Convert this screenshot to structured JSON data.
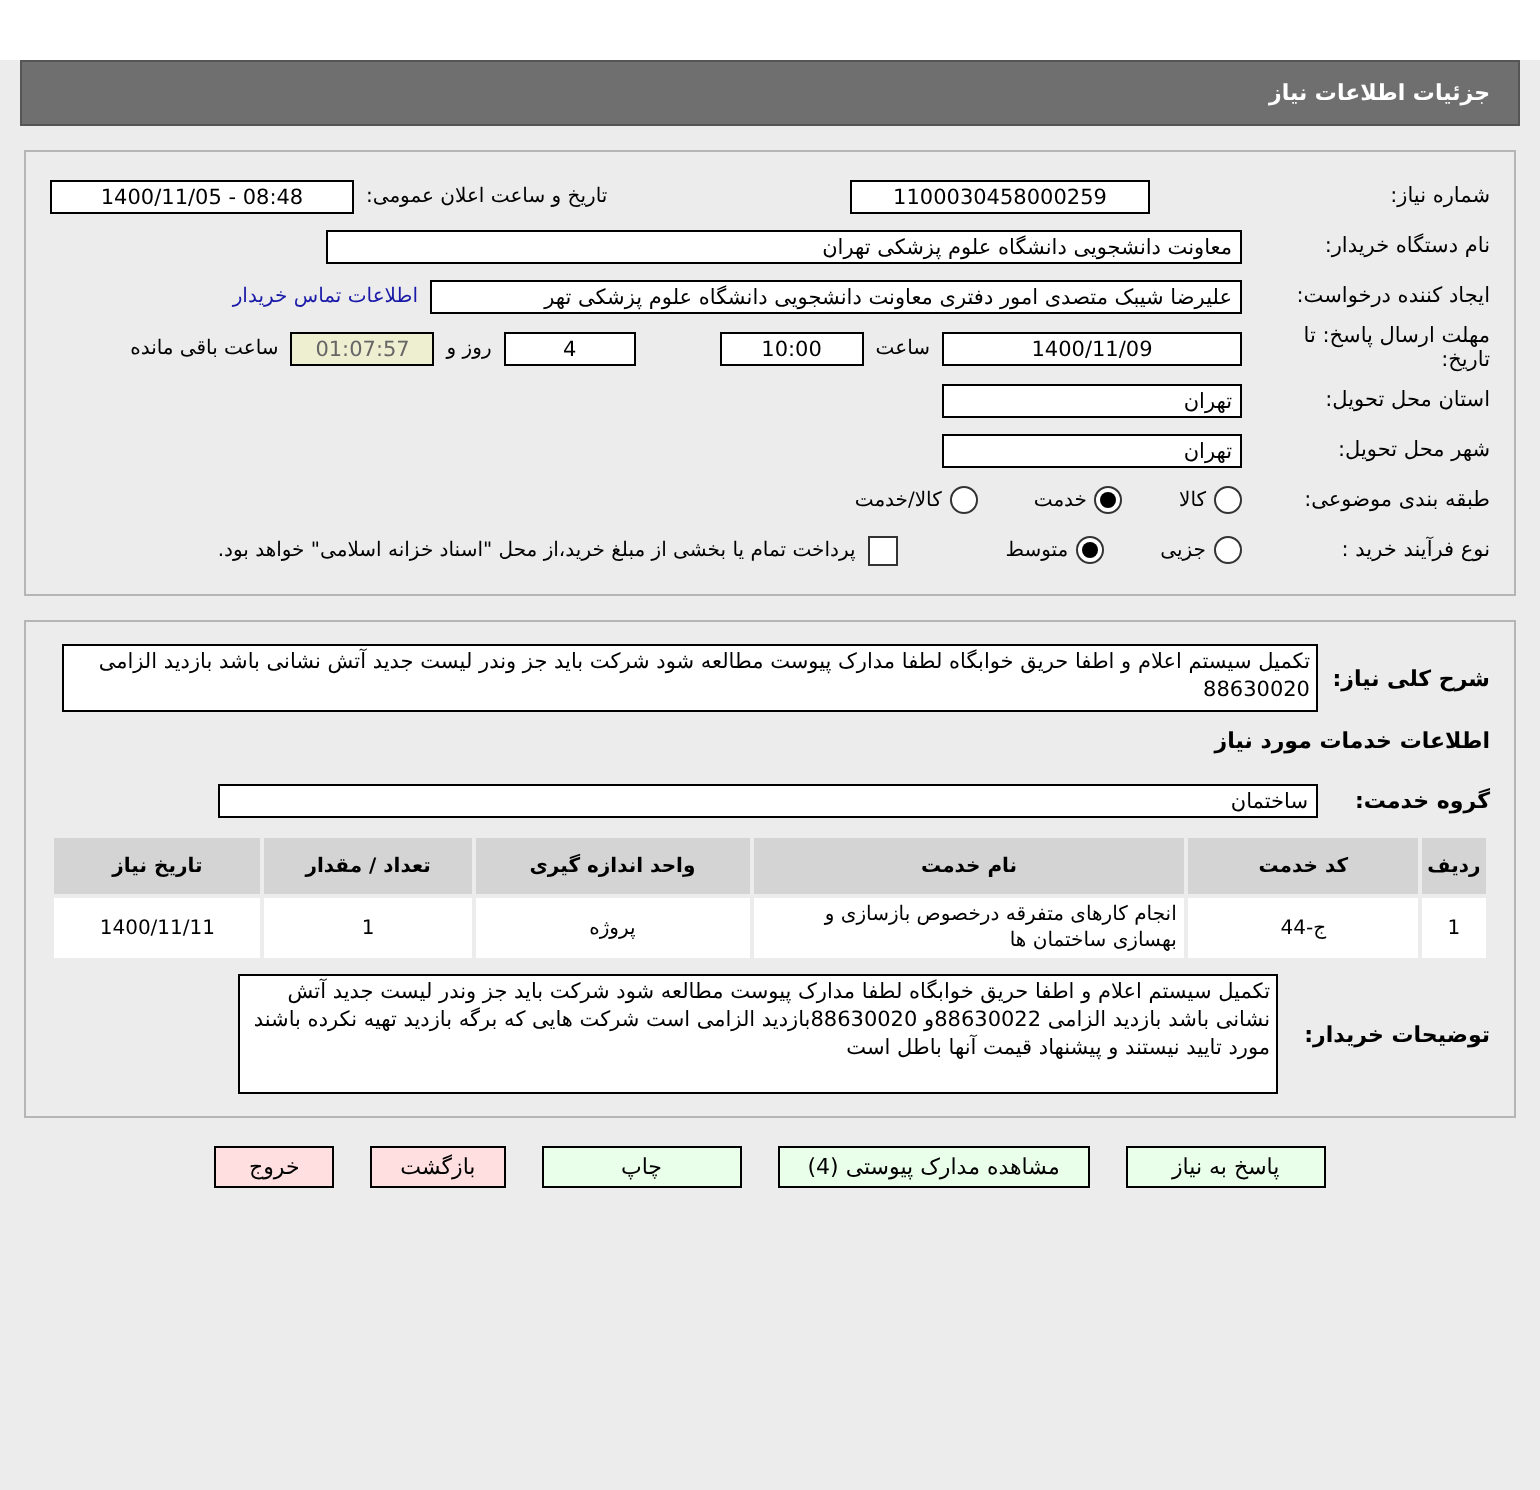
{
  "header": {
    "title": "جزئیات اطلاعات نیاز"
  },
  "details": {
    "need_number": {
      "label": "شماره نیاز:",
      "value": "1100030458000259"
    },
    "announce_date": {
      "label": "تاریخ و ساعت اعلان عمومی:",
      "value": "1400/11/05 - 08:48"
    },
    "buyer_org": {
      "label": "نام دستگاه خریدار:",
      "value": "معاونت دانشجویی دانشگاه علوم پزشکی تهران"
    },
    "requester": {
      "label": "ایجاد کننده درخواست:",
      "value": "علیرضا شیبک متصدی امور دفتری معاونت دانشجویی دانشگاه علوم پزشکی تهر",
      "link": "اطلاعات تماس خریدار"
    },
    "deadline": {
      "label": "مهلت ارسال پاسخ: تا تاریخ:",
      "date": "1400/11/09",
      "time_label": "ساعت",
      "time": "10:00",
      "days": "4",
      "days_label": "روز و",
      "remaining": "01:07:57",
      "remaining_label": "ساعت باقی مانده"
    },
    "province": {
      "label": "استان محل تحویل:",
      "value": "تهران"
    },
    "city": {
      "label": "شهر محل تحویل:",
      "value": "تهران"
    },
    "category": {
      "label": "طبقه بندی موضوعی:",
      "options": [
        {
          "label": "کالا",
          "selected": false
        },
        {
          "label": "خدمت",
          "selected": true
        },
        {
          "label": "کالا/خدمت",
          "selected": false
        }
      ]
    },
    "process": {
      "label": "نوع فرآیند خرید :",
      "options": [
        {
          "label": "جزیی",
          "selected": false
        },
        {
          "label": "متوسط",
          "selected": true
        }
      ],
      "treasury": {
        "label": "پرداخت تمام یا بخشی از مبلغ خرید،از محل \"اسناد خزانه اسلامی\" خواهد بود.",
        "checked": false
      }
    }
  },
  "services": {
    "summary": {
      "label": "شرح کلی نیاز:",
      "value": "تکمیل سیستم اعلام و اطفا حریق خوابگاه لطفا مدارک پیوست مطالعه شود شرکت باید جز وندر لیست جدید آتش نشانی باشد بازدید الزامی  88630020"
    },
    "heading": "اطلاعات خدمات مورد نیاز",
    "group": {
      "label": "گروه خدمت:",
      "value": "ساختمان"
    },
    "table": {
      "columns": [
        "ردیف",
        "کد خدمت",
        "نام خدمت",
        "واحد اندازه گیری",
        "تعداد / مقدار",
        "تاریخ نیاز"
      ],
      "rows": [
        [
          "1",
          "ج-44",
          "انجام کارهای متفرقه درخصوص بازسازی و بهسازی ساختمان ها",
          "پروژه",
          "1",
          "1400/11/11"
        ]
      ]
    },
    "buyer_notes": {
      "label": "توضیحات خریدار:",
      "value": "تکمیل سیستم اعلام و اطفا حریق خوابگاه لطفا مدارک پیوست مطالعه شود شرکت باید جز وندر لیست جدید آتش نشانی باشد بازدید الزامی 88630022و 88630020بازدید الزامی است شرکت هایی که برگه بازدید تهیه نکرده باشند مورد تایید نیستند و پیشنهاد قیمت آنها باطل است"
    }
  },
  "buttons": [
    {
      "label": "پاسخ به نیاز",
      "kind": "action"
    },
    {
      "label": "مشاهده مدارک پیوستی (4)",
      "kind": "action"
    },
    {
      "label": "چاپ",
      "kind": "action"
    },
    {
      "label": "بازگشت",
      "kind": "exit"
    },
    {
      "label": "خروج",
      "kind": "exit"
    }
  ]
}
